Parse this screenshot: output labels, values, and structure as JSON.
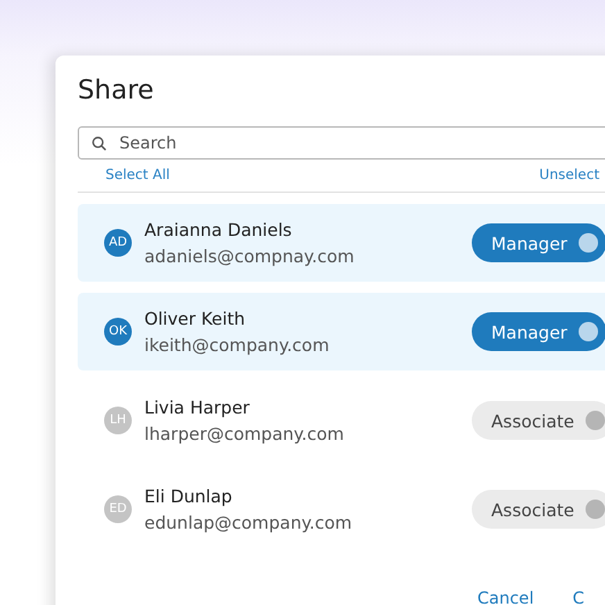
{
  "dialog": {
    "title": "Share",
    "search": {
      "placeholder": "Search"
    },
    "select_all": "Select All",
    "unselect": "Unselect",
    "people": [
      {
        "initials": "AD",
        "name": "Araianna Daniels",
        "email": "adaniels@compnay.com",
        "role": "Manager",
        "selected": true
      },
      {
        "initials": "OK",
        "name": "Oliver Keith",
        "email": "ikeith@company.com",
        "role": "Manager",
        "selected": true
      },
      {
        "initials": "LH",
        "name": "Livia Harper",
        "email": "lharper@company.com",
        "role": "Associate",
        "selected": false
      },
      {
        "initials": "ED",
        "name": "Eli Dunlap",
        "email": "edunlap@company.com",
        "role": "Associate",
        "selected": false
      }
    ],
    "buttons": [
      "Cancel",
      "C"
    ]
  }
}
